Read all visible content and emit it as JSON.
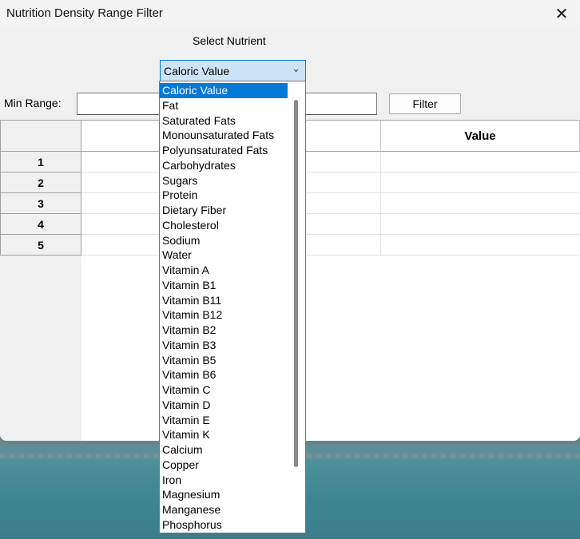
{
  "window": {
    "title": "Nutrition Density Range Filter",
    "close_glyph": "✕"
  },
  "nutrient_select": {
    "label": "Select Nutrient",
    "selected": "Caloric Value",
    "options": [
      "Caloric Value",
      "Fat",
      "Saturated Fats",
      "Monounsaturated Fats",
      "Polyunsaturated Fats",
      "Carbohydrates",
      "Sugars",
      "Protein",
      "Dietary Fiber",
      "Cholesterol",
      "Sodium",
      "Water",
      "Vitamin A",
      "Vitamin B1",
      "Vitamin B11",
      "Vitamin B12",
      "Vitamin B2",
      "Vitamin B3",
      "Vitamin B5",
      "Vitamin B6",
      "Vitamin C",
      "Vitamin D",
      "Vitamin E",
      "Vitamin K",
      "Calcium",
      "Copper",
      "Iron",
      "Magnesium",
      "Manganese",
      "Phosphorus"
    ]
  },
  "range": {
    "min_label": "Min Range:",
    "min_value": ""
  },
  "filter_button": {
    "label": "Filter"
  },
  "table": {
    "columns": [
      "",
      "Value"
    ],
    "row_headers": [
      "1",
      "2",
      "3",
      "4",
      "5"
    ]
  },
  "icons": {
    "close": "close-icon",
    "dropdown": "chevron-down-icon"
  },
  "colors": {
    "selection": "#0078d7",
    "combo_bg": "#cce4f7"
  }
}
